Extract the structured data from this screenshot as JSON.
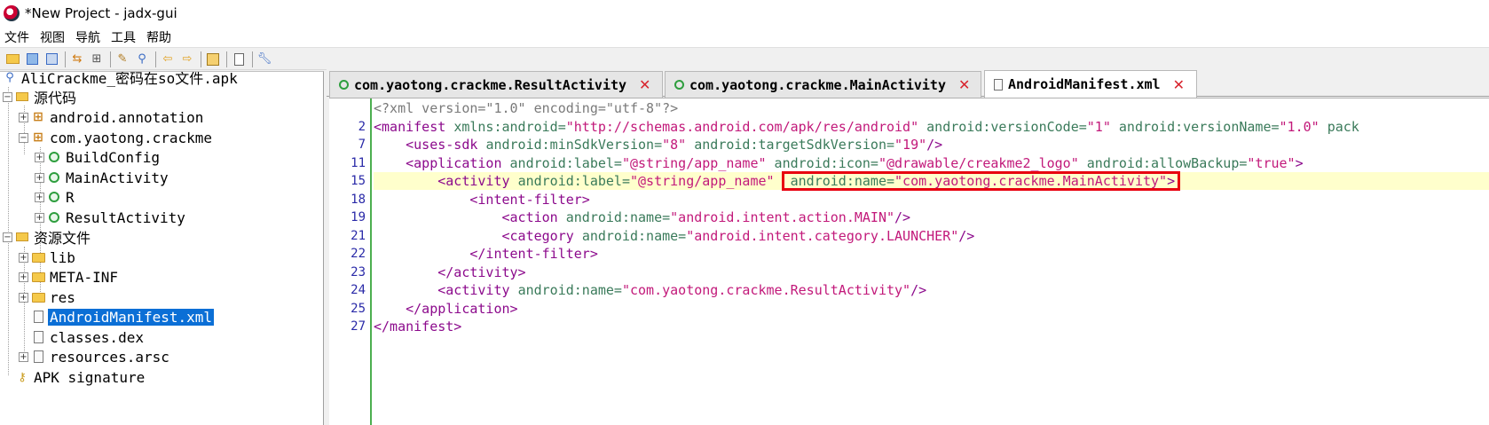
{
  "window": {
    "title": "*New Project - jadx-gui"
  },
  "menu": {
    "items": [
      "文件",
      "视图",
      "导航",
      "工具",
      "帮助"
    ]
  },
  "toolbar": {
    "buttons": [
      "open-folder-icon",
      "save-all-icon",
      "export-icon",
      "sync-icon",
      "flatten-packages-icon",
      "decompile-icon",
      "search-icon",
      "back-icon",
      "forward-icon",
      "log-icon",
      "preferences-icon",
      "settings-icon"
    ]
  },
  "tree": {
    "root": "AliCrackme_密码在so文件.apk",
    "source_code": "源代码",
    "pkg_annotation": "android.annotation",
    "pkg_crackme": "com.yaotong.crackme",
    "cls_buildconfig": "BuildConfig",
    "cls_mainactivity": "MainActivity",
    "cls_r": "R",
    "cls_resultactivity": "ResultActivity",
    "resources": "资源文件",
    "dir_lib": "lib",
    "dir_metainf": "META-INF",
    "dir_res": "res",
    "file_manifest": "AndroidManifest.xml",
    "file_classes": "classes.dex",
    "file_arsc": "resources.arsc",
    "apk_signature": "APK signature"
  },
  "tabs": [
    {
      "label": "com.yaotong.crackme.ResultActivity",
      "active": false
    },
    {
      "label": "com.yaotong.crackme.MainActivity",
      "active": false
    },
    {
      "label": "AndroidManifest.xml",
      "active": true
    }
  ],
  "editor": {
    "line_numbers": [
      "",
      "2",
      "7",
      "11",
      "15",
      "18",
      "19",
      "21",
      "22",
      "23",
      "24",
      "25",
      "27"
    ],
    "lines": [
      [
        {
          "t": "pi",
          "s": "<?xml version=\"1.0\" encoding=\"utf-8\"?>"
        }
      ],
      [
        {
          "t": "tag",
          "s": "<manifest "
        },
        {
          "t": "attr",
          "s": "xmlns:android="
        },
        {
          "t": "val",
          "s": "\"http://schemas.android.com/apk/res/android\""
        },
        {
          "t": "attr",
          "s": " android:versionCode="
        },
        {
          "t": "val",
          "s": "\"1\""
        },
        {
          "t": "attr",
          "s": " android:versionName="
        },
        {
          "t": "val",
          "s": "\"1.0\""
        },
        {
          "t": "attr",
          "s": " pack"
        }
      ],
      [
        {
          "t": "tag",
          "s": "    <uses-sdk "
        },
        {
          "t": "attr",
          "s": "android:minSdkVersion="
        },
        {
          "t": "val",
          "s": "\"8\""
        },
        {
          "t": "attr",
          "s": " android:targetSdkVersion="
        },
        {
          "t": "val",
          "s": "\"19\""
        },
        {
          "t": "tag",
          "s": "/>"
        }
      ],
      [
        {
          "t": "tag",
          "s": "    <application "
        },
        {
          "t": "attr",
          "s": "android:label="
        },
        {
          "t": "val",
          "s": "\"@string/app_name\""
        },
        {
          "t": "attr",
          "s": " android:icon="
        },
        {
          "t": "val",
          "s": "\"@drawable/creakme2_logo\""
        },
        {
          "t": "attr",
          "s": " android:allowBackup="
        },
        {
          "t": "val",
          "s": "\"true\""
        },
        {
          "t": "tag",
          "s": ">"
        }
      ],
      [
        {
          "t": "tag",
          "s": "        <activity "
        },
        {
          "t": "attr",
          "s": "android:label="
        },
        {
          "t": "val",
          "s": "\"@string/app_name\""
        },
        {
          "t": "attr",
          "s": "  android:name="
        },
        {
          "t": "val",
          "s": "\"com.yaotong.crackme.MainActivity\""
        },
        {
          "t": "tag",
          "s": ">"
        }
      ],
      [
        {
          "t": "tag",
          "s": "            <intent-filter>"
        }
      ],
      [
        {
          "t": "tag",
          "s": "                <action "
        },
        {
          "t": "attr",
          "s": "android:name="
        },
        {
          "t": "val",
          "s": "\"android.intent.action.MAIN\""
        },
        {
          "t": "tag",
          "s": "/>"
        }
      ],
      [
        {
          "t": "tag",
          "s": "                <category "
        },
        {
          "t": "attr",
          "s": "android:name="
        },
        {
          "t": "val",
          "s": "\"android.intent.category.LAUNCHER\""
        },
        {
          "t": "tag",
          "s": "/>"
        }
      ],
      [
        {
          "t": "tag",
          "s": "            </intent-filter>"
        }
      ],
      [
        {
          "t": "tag",
          "s": "        </activity>"
        }
      ],
      [
        {
          "t": "tag",
          "s": "        <activity "
        },
        {
          "t": "attr",
          "s": "android:name="
        },
        {
          "t": "val",
          "s": "\"com.yaotong.crackme.ResultActivity\""
        },
        {
          "t": "tag",
          "s": "/>"
        }
      ],
      [
        {
          "t": "tag",
          "s": "    </application>"
        }
      ],
      [
        {
          "t": "tag",
          "s": "</manifest>"
        }
      ]
    ],
    "highlighted_line": 4
  },
  "colors": {
    "selection": "#0b6fd6",
    "line_highlight": "#ffffcc",
    "annotation_box": "#e8000f",
    "gutter_border": "#4caf50",
    "tag": "#8c0a8c",
    "attr": "#3a7a5a",
    "value": "#c2197a",
    "close_x": "#d8242e"
  }
}
